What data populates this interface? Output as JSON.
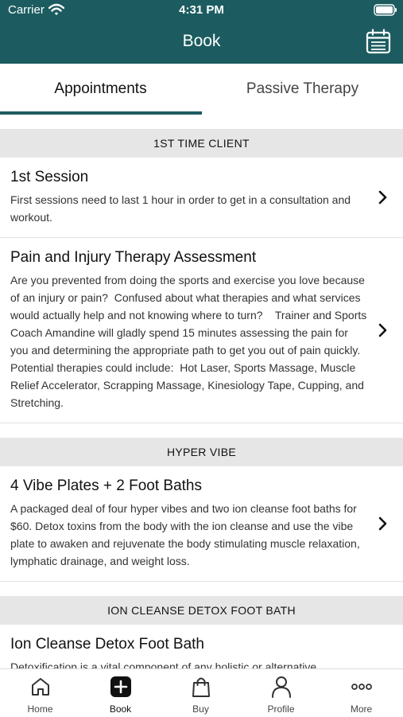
{
  "status_bar": {
    "carrier": "Carrier",
    "time": "4:31 PM"
  },
  "nav": {
    "title": "Book",
    "calendar_icon": "calendar-icon"
  },
  "tabs": [
    {
      "label": "Appointments",
      "active": true
    },
    {
      "label": "Passive Therapy",
      "active": false
    }
  ],
  "sections": [
    {
      "header": "1ST TIME CLIENT",
      "items": [
        {
          "title": "1st Session",
          "description": "First sessions need to last 1 hour in order to get in a consultation and workout."
        },
        {
          "title": "Pain and Injury Therapy Assessment",
          "description": "Are you prevented from doing the sports and exercise you love because of an injury or pain?  Confused about what therapies and what services would actually help and not knowing where to turn?    Trainer and Sports Coach Amandine will gladly spend 15 minutes assessing the pain for you and determining the appropriate path to get you out of pain quickly.     Potential therapies could include:  Hot Laser, Sports Massage, Muscle Relief Accelerator, Scrapping Massage, Kinesiology Tape, Cupping, and Stretching."
        }
      ]
    },
    {
      "header": "HYPER VIBE",
      "items": [
        {
          "title": "4 Vibe Plates + 2 Foot Baths",
          "description": "A packaged deal of four hyper vibes and two ion cleanse foot baths for $60. Detox toxins from the body with the ion cleanse and use the vibe plate to awaken and rejuvenate the body stimulating muscle relaxation, lymphatic drainage, and weight loss."
        }
      ]
    },
    {
      "header": "ION CLEANSE DETOX FOOT BATH",
      "items": [
        {
          "title": "Ion Cleanse Detox Foot Bath",
          "description": "Detoxification is a vital component of any holistic or alternative"
        }
      ]
    }
  ],
  "tab_bar": [
    {
      "label": "Home",
      "icon": "home-icon",
      "active": false
    },
    {
      "label": "Book",
      "icon": "plus-square-icon",
      "active": true
    },
    {
      "label": "Buy",
      "icon": "shopping-bag-icon",
      "active": false
    },
    {
      "label": "Profile",
      "icon": "person-icon",
      "active": false
    },
    {
      "label": "More",
      "icon": "ellipsis-icon",
      "active": false
    }
  ],
  "colors": {
    "brand": "#1c5c60",
    "section_bg": "#e6e6e6"
  }
}
